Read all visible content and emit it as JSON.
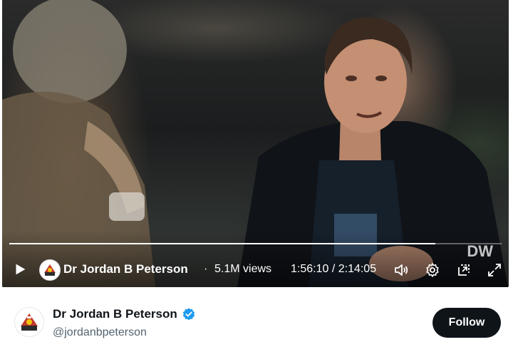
{
  "video": {
    "channel_name": "Dr Jordan B Peterson",
    "separator": "·",
    "views": "5.1M views",
    "time": "1:56:10 / 2:14:05",
    "progress": 0.866,
    "watermark": "DW"
  },
  "author": {
    "name": "Dr Jordan B Peterson",
    "handle": "@jordanbpeterson",
    "verified": true
  },
  "follow_label": "Follow",
  "colors": {
    "follow_button": "#0f1419",
    "verified_badge": "#1d9bf0",
    "handle_text": "#536471"
  }
}
